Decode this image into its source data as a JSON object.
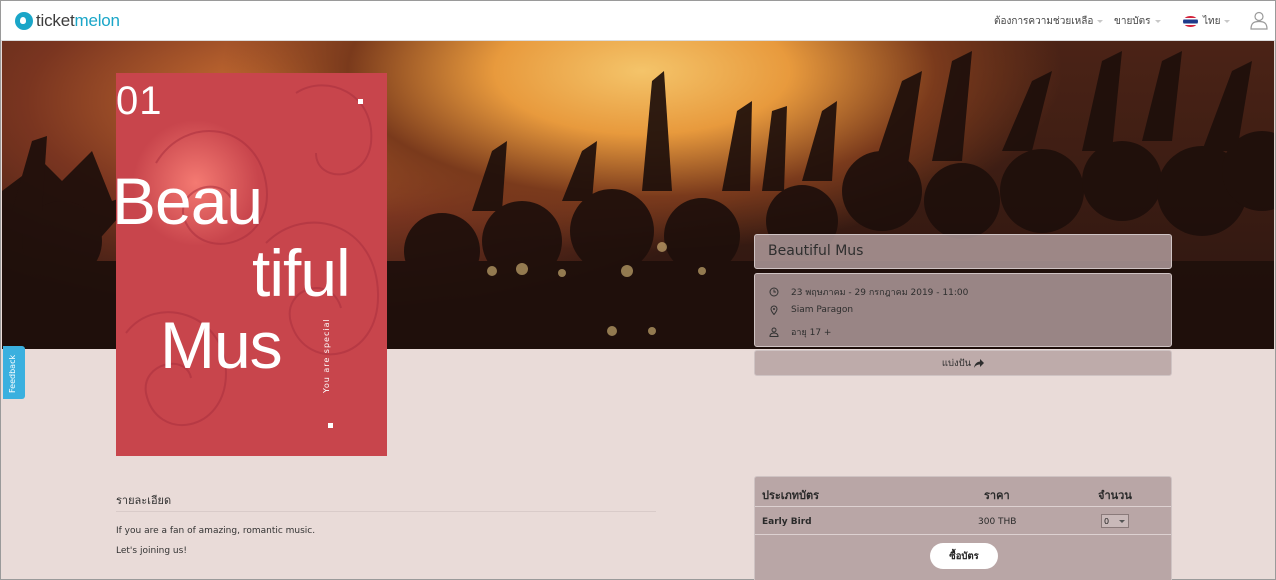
{
  "brand": {
    "name_part1": "ticket",
    "name_part2": "melon"
  },
  "nav": {
    "help_label": "ต้องการความช่วยเหลือ",
    "sell_label": "ขายบัตร",
    "language_label": "ไทย"
  },
  "poster": {
    "number": "01",
    "line1": "Beau",
    "line2": "tiful",
    "line3": "Mus",
    "side_text": "You are special"
  },
  "feedback_label": "Feedback",
  "event": {
    "title": "Beautiful Mus",
    "date": "23 พฤษภาคม - 29 กรกฎาคม 2019 - 11:00",
    "venue": "Siam Paragon",
    "age": "อายุ 17 +",
    "share_label": "แบ่งปัน"
  },
  "details": {
    "heading": "รายละเอียด",
    "paragraphs": [
      "If you are a fan of amazing, romantic music.",
      "Let's joining us!"
    ]
  },
  "tickets": {
    "headers": {
      "type": "ประเภทบัตร",
      "price": "ราคา",
      "qty": "จำนวน"
    },
    "rows": [
      {
        "type": "Early Bird",
        "price": "300 THB",
        "qty": "0"
      }
    ],
    "buy_label": "ซื้อบัตร"
  }
}
